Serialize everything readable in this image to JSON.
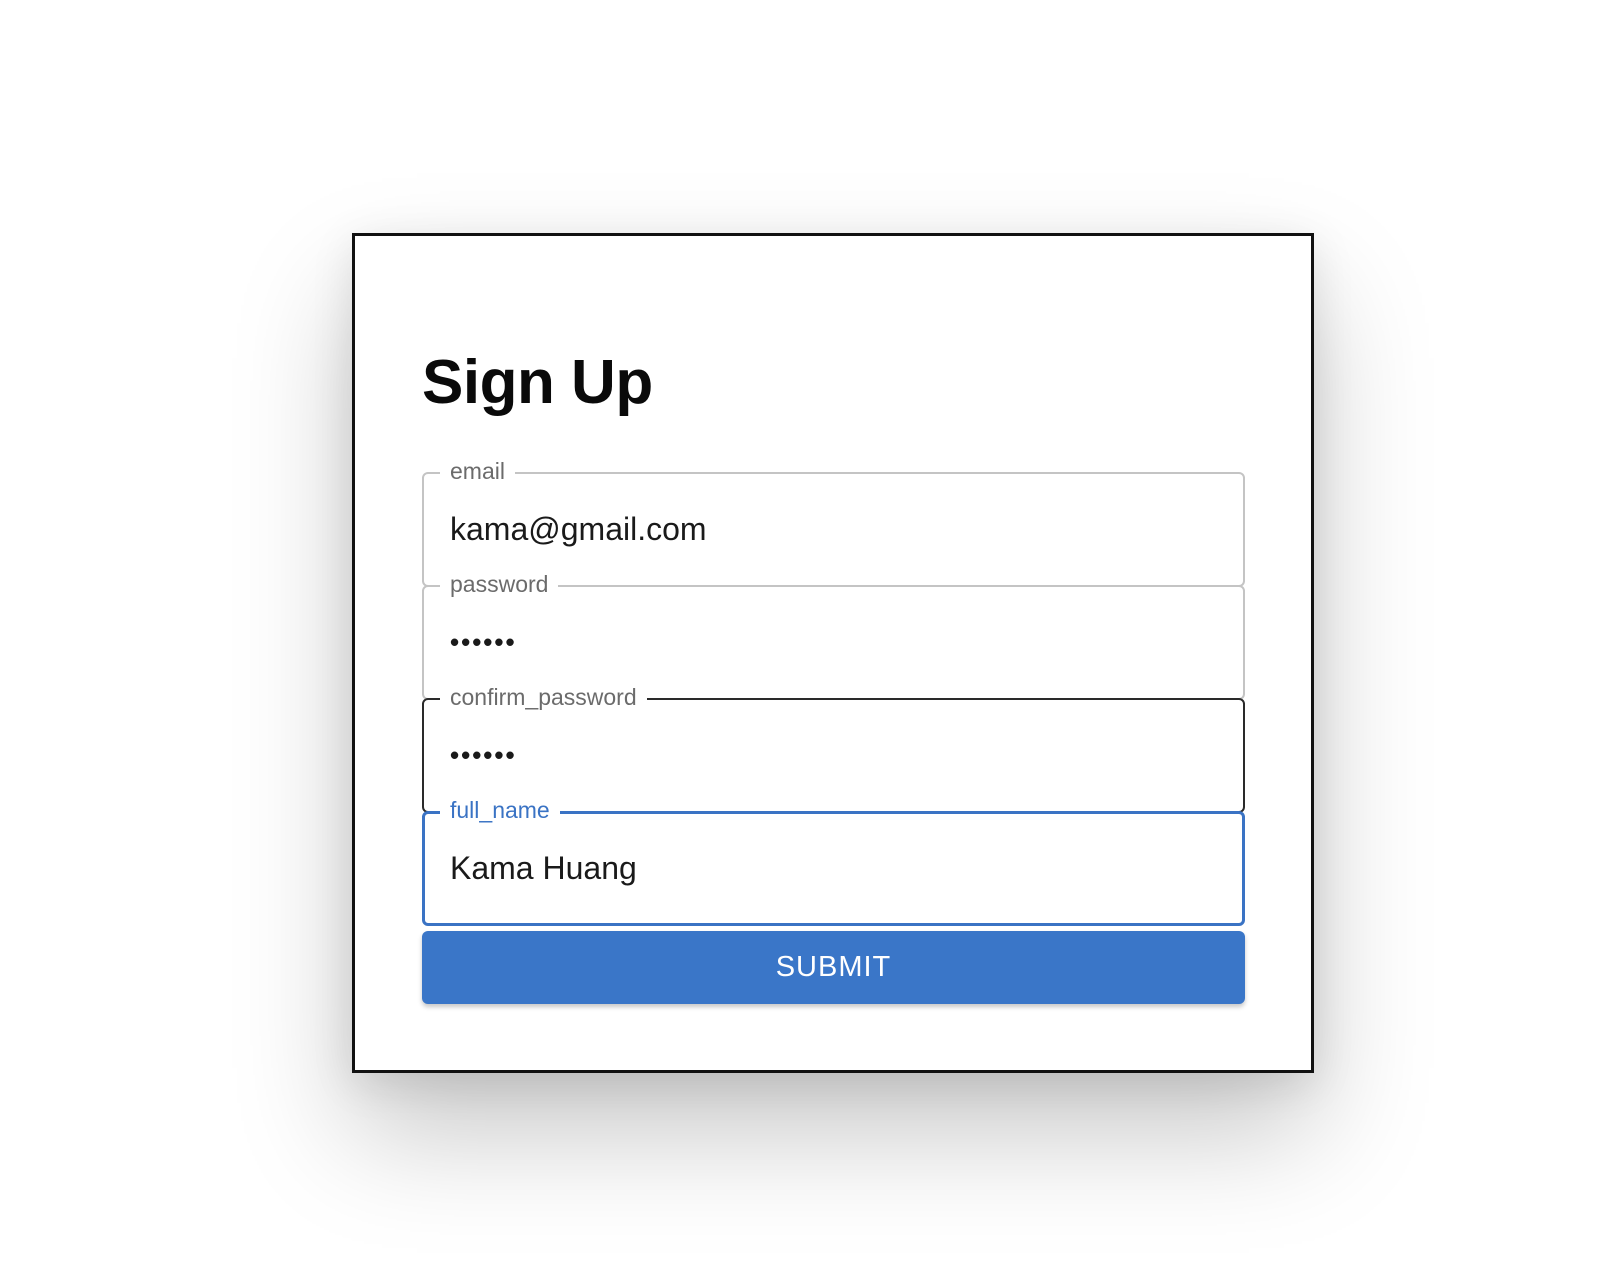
{
  "form": {
    "title": "Sign Up",
    "fields": [
      {
        "label": "email",
        "value": "kama@gmail.com"
      },
      {
        "label": "password",
        "value": "••••••"
      },
      {
        "label": "confirm_password",
        "value": "••••••"
      },
      {
        "label": "full_name",
        "value": "Kama Huang"
      }
    ],
    "submit_label": "SUBMIT"
  },
  "colors": {
    "accent": "#3a76c8",
    "focus_outline": "#3a73c4",
    "field_border": "#c4c4c4",
    "label_text": "#6b6b6b"
  }
}
